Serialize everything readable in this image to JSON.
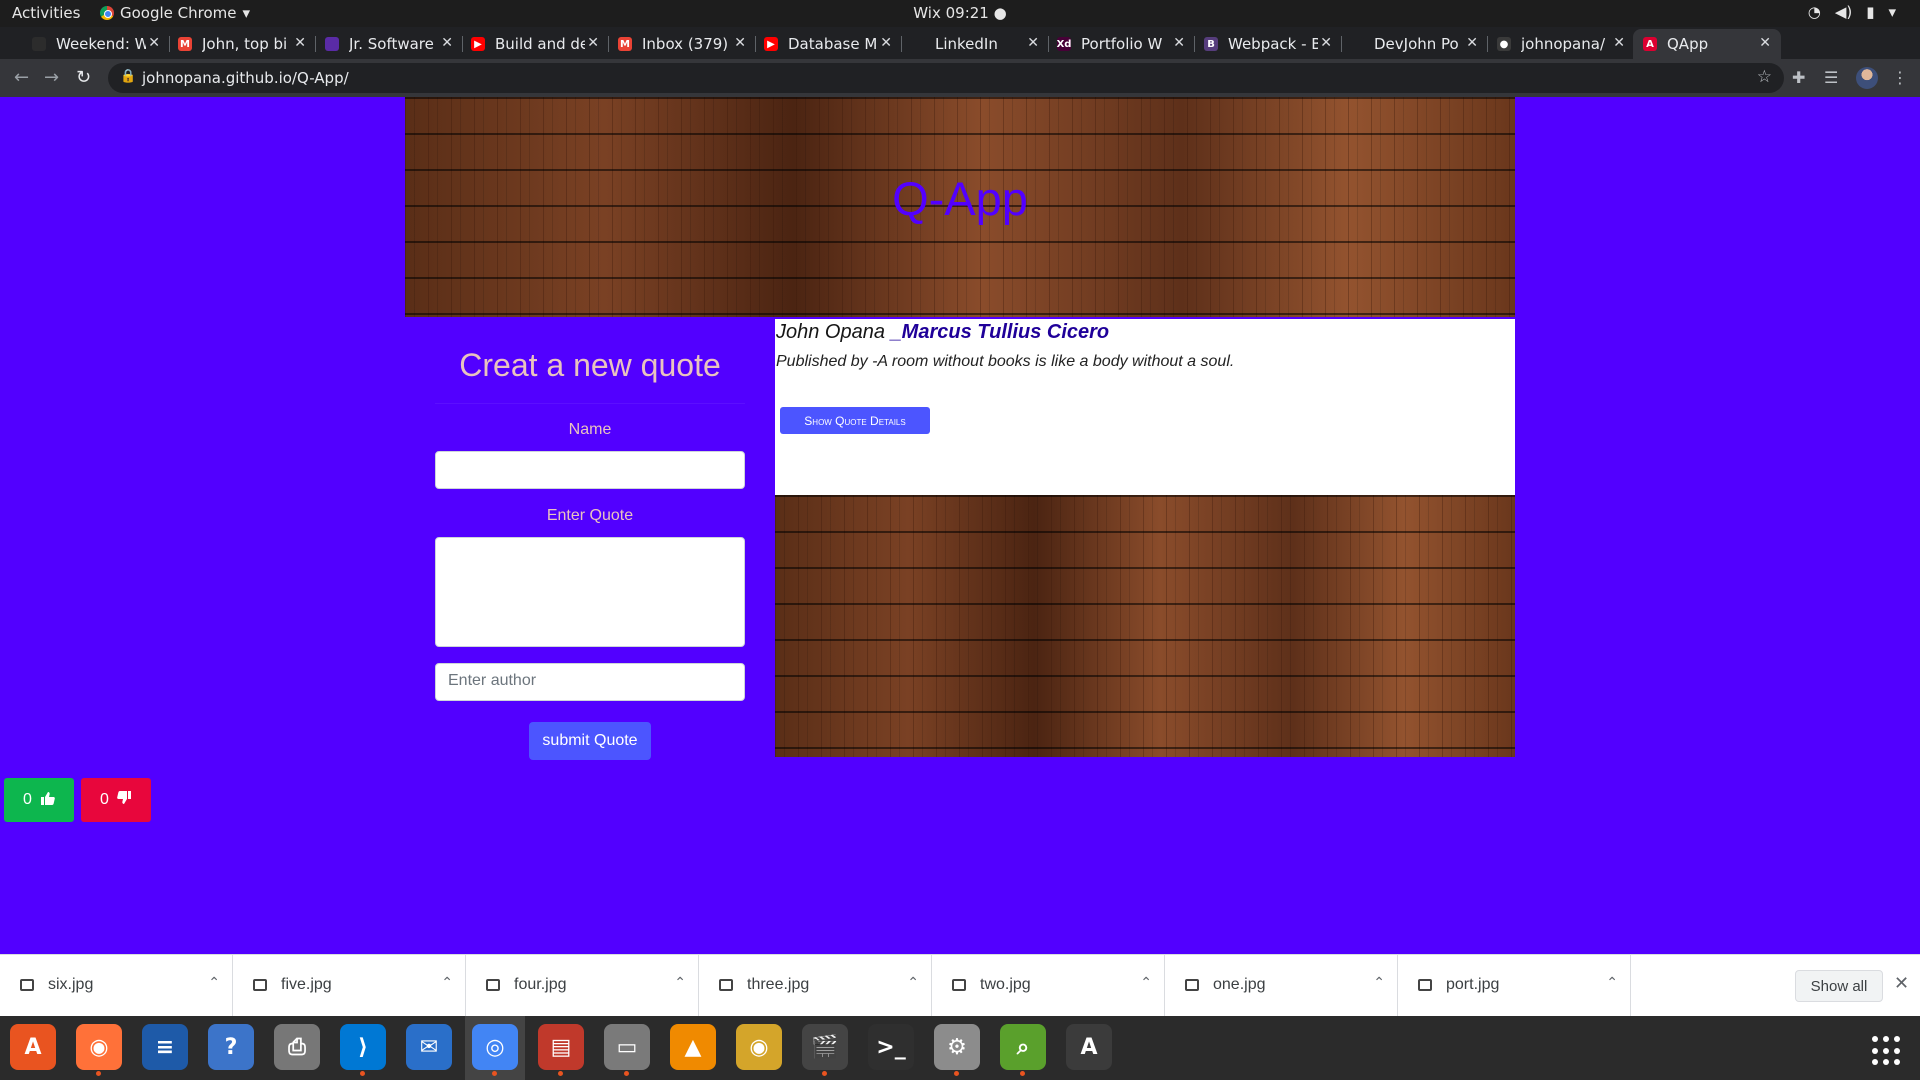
{
  "system": {
    "activities": "Activities",
    "app_name": "Google Chrome",
    "clock": "Wix 09:21 ●"
  },
  "tabs": [
    {
      "title": "Weekend: W",
      "fav_color": "#2c2c2c",
      "fav_glyph": ""
    },
    {
      "title": "John, top bi",
      "fav_color": "#ea4335",
      "fav_glyph": "M"
    },
    {
      "title": "Jr. Software",
      "fav_color": "#5a2ba6",
      "fav_glyph": ""
    },
    {
      "title": "Build and de",
      "fav_color": "#ff0000",
      "fav_glyph": "▶"
    },
    {
      "title": "Inbox (379)",
      "fav_color": "#ea4335",
      "fav_glyph": "M"
    },
    {
      "title": "Database M",
      "fav_color": "#ff0000",
      "fav_glyph": "▶"
    },
    {
      "title": "LinkedIn",
      "fav_color": "#202124",
      "fav_glyph": ""
    },
    {
      "title": "Portfolio W",
      "fav_color": "#470137",
      "fav_glyph": "Xd"
    },
    {
      "title": "Webpack - B",
      "fav_color": "#563d7c",
      "fav_glyph": "B"
    },
    {
      "title": "DevJohn Po",
      "fav_color": "#202124",
      "fav_glyph": ""
    },
    {
      "title": "johnopana/",
      "fav_color": "#3a3a3a",
      "fav_glyph": "●"
    },
    {
      "title": "QApp",
      "fav_color": "#dd0031",
      "fav_glyph": "A"
    }
  ],
  "browser": {
    "url": "johnopana.github.io/Q-App/"
  },
  "page": {
    "app_title": "Q-App",
    "form": {
      "heading": "Creat a new quote",
      "name_label": "Name",
      "name_value": "",
      "quote_label": "Enter Quote",
      "quote_value": "",
      "author_placeholder": "Enter author",
      "submit_label": "submit Quote"
    },
    "quote": {
      "poster": "John Opana",
      "author": "_Marcus Tullius Cicero",
      "published_line": "Published by -A room without books is like a body without a soul.",
      "details_button": "Show Quote Details"
    },
    "votes": {
      "up": "0",
      "down": "0",
      "up_icon": "thumbs-up",
      "down_icon": "thumbs-down"
    },
    "colors": {
      "background": "#5200ff",
      "button": "#4c55ff",
      "upvote": "#0db64e",
      "downvote": "#e8063c"
    }
  },
  "downloads": {
    "files": [
      "six.jpg",
      "five.jpg",
      "four.jpg",
      "three.jpg",
      "two.jpg",
      "one.jpg",
      "port.jpg"
    ],
    "show_all": "Show all"
  },
  "dock": {
    "apps": [
      {
        "name": "ubuntu-software",
        "color": "#e95420",
        "glyph": "A"
      },
      {
        "name": "firefox",
        "color": "#ff7139",
        "glyph": "◉"
      },
      {
        "name": "libreoffice-writer",
        "color": "#1e5aa8",
        "glyph": "≡"
      },
      {
        "name": "help",
        "color": "#3c74c9",
        "glyph": "?"
      },
      {
        "name": "printer",
        "color": "#777777",
        "glyph": "⎙"
      },
      {
        "name": "vscode",
        "color": "#0078d4",
        "glyph": "⟩"
      },
      {
        "name": "thunderbird",
        "color": "#2a6fc9",
        "glyph": "✉"
      },
      {
        "name": "chrome",
        "color": "#4285f4",
        "glyph": "◎"
      },
      {
        "name": "document-viewer",
        "color": "#c0392b",
        "glyph": "▤"
      },
      {
        "name": "file-manager",
        "color": "#7a7a7a",
        "glyph": "▭"
      },
      {
        "name": "vlc",
        "color": "#f08a00",
        "glyph": "▲"
      },
      {
        "name": "rhythmbox",
        "color": "#d4a52a",
        "glyph": "◉"
      },
      {
        "name": "video-editor",
        "color": "#444444",
        "glyph": "🎬"
      },
      {
        "name": "terminal",
        "color": "#2f2f2f",
        "glyph": ">_"
      },
      {
        "name": "settings",
        "color": "#8c8c8c",
        "glyph": "⚙"
      },
      {
        "name": "image-viewer",
        "color": "#5aa02c",
        "glyph": "⌕"
      },
      {
        "name": "software-updater",
        "color": "#3b3b3b",
        "glyph": "A"
      }
    ]
  }
}
